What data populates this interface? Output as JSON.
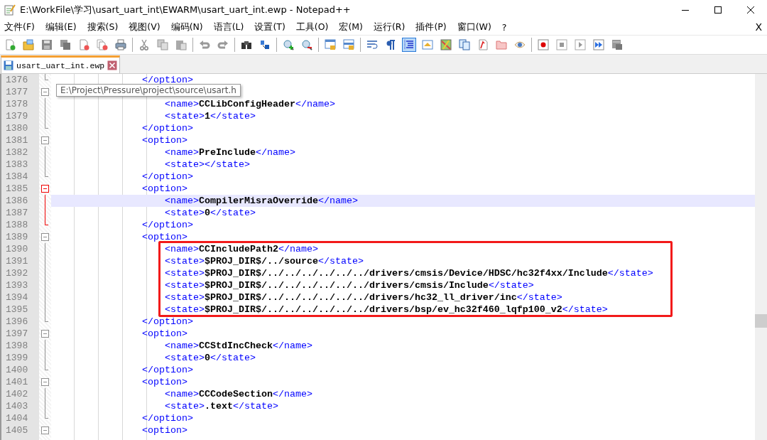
{
  "window": {
    "title": "E:\\WorkFile\\学习\\usart_uart_int\\EWARM\\usart_uart_int.ewp - Notepad++"
  },
  "menu": [
    "文件(F)",
    "编辑(E)",
    "搜索(S)",
    "视图(V)",
    "编码(N)",
    "语言(L)",
    "设置(T)",
    "工具(O)",
    "宏(M)",
    "运行(R)",
    "插件(P)",
    "窗口(W)",
    "?"
  ],
  "menu_close": "X",
  "toolbar_groups": [
    {
      "items": [
        {
          "kind": "new",
          "on": false
        },
        {
          "kind": "open",
          "on": false
        },
        {
          "kind": "save",
          "on": false
        },
        {
          "kind": "save_all",
          "on": false
        },
        {
          "kind": "close",
          "on": false
        },
        {
          "kind": "close_all",
          "on": false
        },
        {
          "kind": "print",
          "on": false
        }
      ]
    },
    {
      "items": [
        {
          "kind": "cut",
          "on": false
        },
        {
          "kind": "copy",
          "on": false
        },
        {
          "kind": "paste",
          "on": false
        }
      ]
    },
    {
      "items": [
        {
          "kind": "undo",
          "on": false
        },
        {
          "kind": "redo",
          "on": false
        }
      ]
    },
    {
      "items": [
        {
          "kind": "find",
          "on": false
        },
        {
          "kind": "replace",
          "on": false
        }
      ]
    },
    {
      "items": [
        {
          "kind": "zoom_in",
          "on": false
        },
        {
          "kind": "zoom_out",
          "on": false
        }
      ]
    },
    {
      "items": [
        {
          "kind": "sync_v",
          "on": false
        },
        {
          "kind": "sync_h",
          "on": false
        }
      ]
    },
    {
      "items": [
        {
          "kind": "wrap",
          "on": false
        },
        {
          "kind": "pilcrow",
          "on": false
        },
        {
          "kind": "indent",
          "on": true
        },
        {
          "kind": "lang",
          "on": false
        },
        {
          "kind": "map",
          "on": false
        },
        {
          "kind": "doclist",
          "on": false
        },
        {
          "kind": "func",
          "on": false
        },
        {
          "kind": "folder",
          "on": false
        },
        {
          "kind": "eye",
          "on": false
        }
      ]
    },
    {
      "items": [
        {
          "kind": "record",
          "on": false
        },
        {
          "kind": "stop",
          "on": false
        },
        {
          "kind": "play",
          "on": false
        },
        {
          "kind": "play_multi",
          "on": false
        },
        {
          "kind": "save_macro",
          "on": false
        }
      ]
    }
  ],
  "tabs": [
    {
      "label": "usart_uart_int.ewp",
      "selected": true
    }
  ],
  "tooltip": {
    "text": "E:\\Project\\Pressure\\project\\source\\usart.h"
  },
  "lines": [
    {
      "number": "1376",
      "kind": "end",
      "fold_active": false,
      "caret": false,
      "boxed": false,
      "parts": [
        {
          "kind": "tag",
          "text": "                </option>"
        }
      ]
    },
    {
      "number": "1377",
      "kind": "open",
      "fold_active": false,
      "caret": false,
      "boxed": false
    },
    {
      "number": "1378",
      "kind": "line",
      "fold_active": false,
      "caret": false,
      "boxed": false,
      "parts": [
        {
          "kind": "tag",
          "text": "                    <name>"
        },
        {
          "kind": "value",
          "text": "CCLibConfigHeader"
        },
        {
          "kind": "tag",
          "text": "</name>"
        }
      ]
    },
    {
      "number": "1379",
      "kind": "line",
      "fold_active": false,
      "caret": false,
      "boxed": false,
      "parts": [
        {
          "kind": "tag",
          "text": "                    <state>"
        },
        {
          "kind": "value",
          "text": "1"
        },
        {
          "kind": "tag",
          "text": "</state>"
        }
      ]
    },
    {
      "number": "1380",
      "kind": "end",
      "fold_active": false,
      "caret": false,
      "boxed": false,
      "parts": [
        {
          "kind": "tag",
          "text": "                </option>"
        }
      ]
    },
    {
      "number": "1381",
      "kind": "open",
      "fold_active": false,
      "caret": false,
      "boxed": false,
      "parts": [
        {
          "kind": "tag",
          "text": "                <option>"
        }
      ]
    },
    {
      "number": "1382",
      "kind": "line",
      "fold_active": false,
      "caret": false,
      "boxed": false,
      "parts": [
        {
          "kind": "tag",
          "text": "                    <name>"
        },
        {
          "kind": "value",
          "text": "PreInclude"
        },
        {
          "kind": "tag",
          "text": "</name>"
        }
      ]
    },
    {
      "number": "1383",
      "kind": "line",
      "fold_active": false,
      "caret": false,
      "boxed": false,
      "parts": [
        {
          "kind": "tag",
          "text": "                    <state></state>"
        }
      ]
    },
    {
      "number": "1384",
      "kind": "end",
      "fold_active": false,
      "caret": false,
      "boxed": false,
      "parts": [
        {
          "kind": "tag",
          "text": "                </option>"
        }
      ]
    },
    {
      "number": "1385",
      "kind": "open",
      "fold_active": true,
      "caret": false,
      "boxed": false,
      "parts": [
        {
          "kind": "tag",
          "text": "                <option>"
        }
      ]
    },
    {
      "number": "1386",
      "kind": "line",
      "fold_active": true,
      "caret": true,
      "boxed": false,
      "parts": [
        {
          "kind": "tag",
          "text": "                    <name>"
        },
        {
          "kind": "value",
          "text": "CompilerMisraOverride"
        },
        {
          "kind": "tag",
          "text": "</name>"
        }
      ]
    },
    {
      "number": "1387",
      "kind": "line",
      "fold_active": true,
      "caret": false,
      "boxed": false,
      "parts": [
        {
          "kind": "tag",
          "text": "                    <state>"
        },
        {
          "kind": "value",
          "text": "0"
        },
        {
          "kind": "tag",
          "text": "</state>"
        }
      ]
    },
    {
      "number": "1388",
      "kind": "end",
      "fold_active": true,
      "caret": false,
      "boxed": false,
      "parts": [
        {
          "kind": "tag",
          "text": "                </option>"
        }
      ]
    },
    {
      "number": "1389",
      "kind": "open",
      "fold_active": false,
      "caret": false,
      "boxed": false,
      "parts": [
        {
          "kind": "tag",
          "text": "                <option>"
        }
      ]
    },
    {
      "number": "1390",
      "kind": "line",
      "fold_active": false,
      "caret": false,
      "boxed": true,
      "parts": [
        {
          "kind": "tag",
          "text": "                    <name>"
        },
        {
          "kind": "value",
          "text": "CCIncludePath2"
        },
        {
          "kind": "tag",
          "text": "</name>"
        }
      ]
    },
    {
      "number": "1391",
      "kind": "line",
      "fold_active": false,
      "caret": false,
      "boxed": true,
      "parts": [
        {
          "kind": "tag",
          "text": "                    <state>"
        },
        {
          "kind": "value",
          "text": "$PROJ_DIR$/../source"
        },
        {
          "kind": "tag",
          "text": "</state>"
        }
      ]
    },
    {
      "number": "1392",
      "kind": "line",
      "fold_active": false,
      "caret": false,
      "boxed": true,
      "parts": [
        {
          "kind": "tag",
          "text": "                    <state>"
        },
        {
          "kind": "value",
          "text": "$PROJ_DIR$/../../../../../../drivers/cmsis/Device/HDSC/hc32f4xx/Include"
        },
        {
          "kind": "tag",
          "text": "</state>"
        }
      ]
    },
    {
      "number": "1393",
      "kind": "line",
      "fold_active": false,
      "caret": false,
      "boxed": true,
      "parts": [
        {
          "kind": "tag",
          "text": "                    <state>"
        },
        {
          "kind": "value",
          "text": "$PROJ_DIR$/../../../../../../drivers/cmsis/Include"
        },
        {
          "kind": "tag",
          "text": "</state>"
        }
      ]
    },
    {
      "number": "1394",
      "kind": "line",
      "fold_active": false,
      "caret": false,
      "boxed": true,
      "parts": [
        {
          "kind": "tag",
          "text": "                    <state>"
        },
        {
          "kind": "value",
          "text": "$PROJ_DIR$/../../../../../../drivers/hc32_ll_driver/inc"
        },
        {
          "kind": "tag",
          "text": "</state>"
        }
      ]
    },
    {
      "number": "1395",
      "kind": "line",
      "fold_active": false,
      "caret": false,
      "boxed": true,
      "parts": [
        {
          "kind": "tag",
          "text": "                    <state>"
        },
        {
          "kind": "value",
          "text": "$PROJ_DIR$/../../../../../../drivers/bsp/ev_hc32f460_lqfp100_v2"
        },
        {
          "kind": "tag",
          "text": "</state>"
        }
      ]
    },
    {
      "number": "1396",
      "kind": "end",
      "fold_active": false,
      "caret": false,
      "boxed": false,
      "parts": [
        {
          "kind": "tag",
          "text": "                </option>"
        }
      ]
    },
    {
      "number": "1397",
      "kind": "open",
      "fold_active": false,
      "caret": false,
      "boxed": false,
      "parts": [
        {
          "kind": "tag",
          "text": "                <option>"
        }
      ]
    },
    {
      "number": "1398",
      "kind": "line",
      "fold_active": false,
      "caret": false,
      "boxed": false,
      "parts": [
        {
          "kind": "tag",
          "text": "                    <name>"
        },
        {
          "kind": "value",
          "text": "CCStdIncCheck"
        },
        {
          "kind": "tag",
          "text": "</name>"
        }
      ]
    },
    {
      "number": "1399",
      "kind": "line",
      "fold_active": false,
      "caret": false,
      "boxed": false,
      "parts": [
        {
          "kind": "tag",
          "text": "                    <state>"
        },
        {
          "kind": "value",
          "text": "0"
        },
        {
          "kind": "tag",
          "text": "</state>"
        }
      ]
    },
    {
      "number": "1400",
      "kind": "end",
      "fold_active": false,
      "caret": false,
      "boxed": false,
      "parts": [
        {
          "kind": "tag",
          "text": "                </option>"
        }
      ]
    },
    {
      "number": "1401",
      "kind": "open",
      "fold_active": false,
      "caret": false,
      "boxed": false,
      "parts": [
        {
          "kind": "tag",
          "text": "                <option>"
        }
      ]
    },
    {
      "number": "1402",
      "kind": "line",
      "fold_active": false,
      "caret": false,
      "boxed": false,
      "parts": [
        {
          "kind": "tag",
          "text": "                    <name>"
        },
        {
          "kind": "value",
          "text": "CCCodeSection"
        },
        {
          "kind": "tag",
          "text": "</name>"
        }
      ]
    },
    {
      "number": "1403",
      "kind": "line",
      "fold_active": false,
      "caret": false,
      "boxed": false,
      "parts": [
        {
          "kind": "tag",
          "text": "                    <state>"
        },
        {
          "kind": "value",
          "text": ".text"
        },
        {
          "kind": "tag",
          "text": "</state>"
        }
      ]
    },
    {
      "number": "1404",
      "kind": "end",
      "fold_active": false,
      "caret": false,
      "boxed": false,
      "parts": [
        {
          "kind": "tag",
          "text": "                </option>"
        }
      ]
    },
    {
      "number": "1405",
      "kind": "open",
      "fold_active": false,
      "caret": false,
      "boxed": false,
      "parts": [
        {
          "kind": "tag",
          "text": "                <option>"
        }
      ]
    }
  ]
}
